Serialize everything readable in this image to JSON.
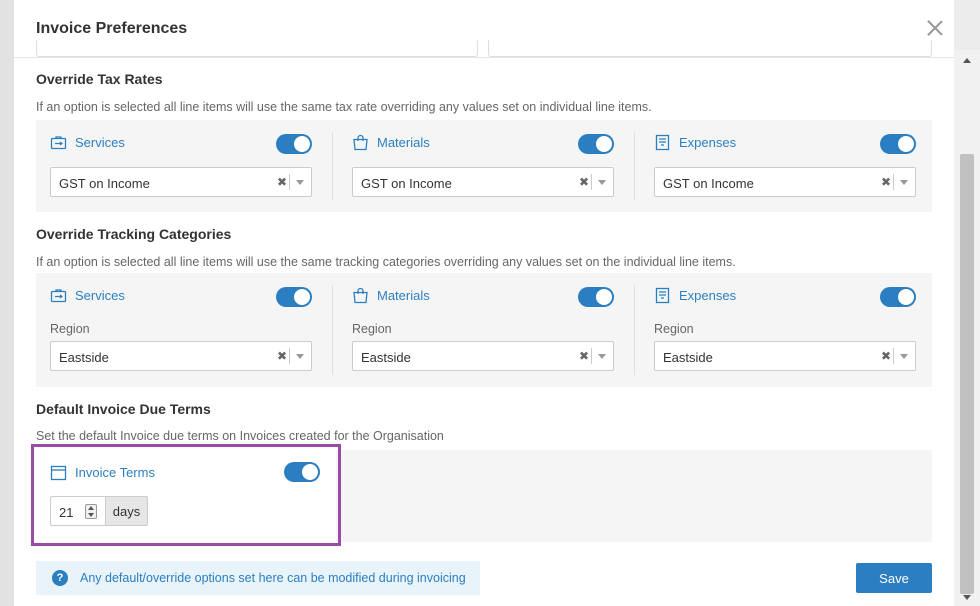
{
  "modal": {
    "title": "Invoice Preferences"
  },
  "tax": {
    "title": "Override Tax Rates",
    "description": "If an option is selected all line items will use the same tax rate overriding any values set on individual line items.",
    "columns": [
      {
        "label": "Services",
        "icon": "briefcase-icon",
        "enabled": true,
        "value": "GST on Income"
      },
      {
        "label": "Materials",
        "icon": "shopping-bag-icon",
        "enabled": true,
        "value": "GST on Income"
      },
      {
        "label": "Expenses",
        "icon": "receipt-icon",
        "enabled": true,
        "value": "GST on Income"
      }
    ]
  },
  "tracking": {
    "title": "Override Tracking Categories",
    "description": "If an option is selected all line items will use the same tracking categories overriding any values set on the individual line items.",
    "columns": [
      {
        "label": "Services",
        "icon": "briefcase-icon",
        "enabled": true,
        "field_label": "Region",
        "value": "Eastside"
      },
      {
        "label": "Materials",
        "icon": "shopping-bag-icon",
        "enabled": true,
        "field_label": "Region",
        "value": "Eastside"
      },
      {
        "label": "Expenses",
        "icon": "receipt-icon",
        "enabled": true,
        "field_label": "Region",
        "value": "Eastside"
      }
    ]
  },
  "terms": {
    "title": "Default Invoice Due Terms",
    "description": "Set the default Invoice due terms on Invoices created for the Organisation",
    "label": "Invoice Terms",
    "icon": "calendar-icon",
    "enabled": true,
    "days_value": "21",
    "days_unit": "days"
  },
  "footer": {
    "note": "Any default/override options set here can be modified during invoicing",
    "save_label": "Save"
  },
  "colors": {
    "accent": "#2b7fc1",
    "highlight": "#9b4aa8"
  }
}
